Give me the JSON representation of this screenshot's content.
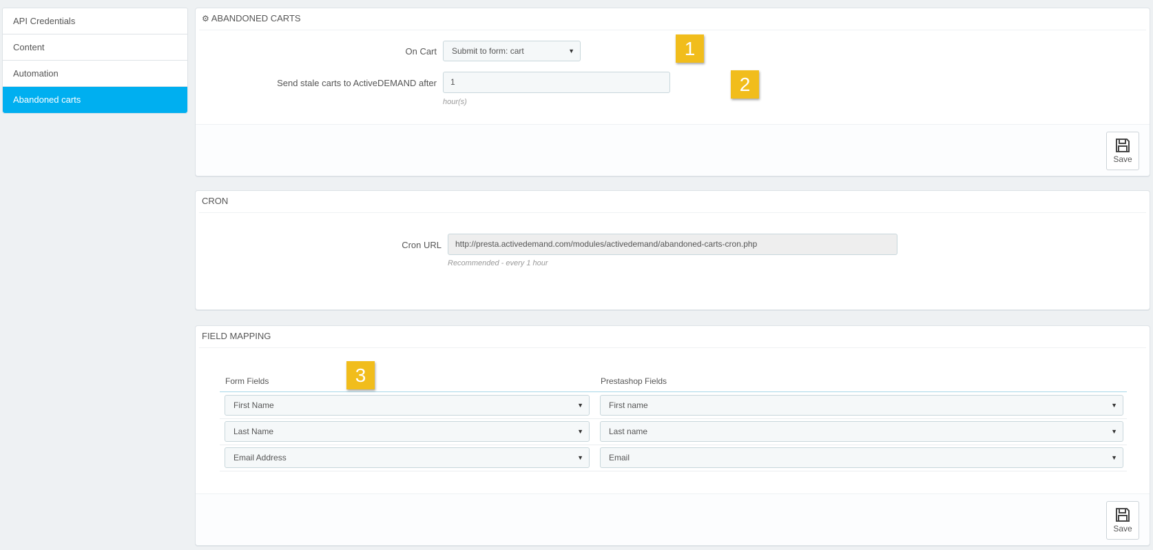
{
  "sidebar": {
    "items": [
      {
        "label": "API Credentials"
      },
      {
        "label": "Content"
      },
      {
        "label": "Automation"
      },
      {
        "label": "Abandoned carts"
      }
    ]
  },
  "abandoned": {
    "title": "ABANDONED CARTS",
    "on_cart_label": "On Cart",
    "on_cart_value": "Submit to form: cart",
    "stale_label": "Send stale carts to ActiveDEMAND after",
    "stale_value": "1",
    "stale_help": "hour(s)",
    "save_label": "Save"
  },
  "cron": {
    "title": "CRON",
    "url_label": "Cron URL",
    "url_value": "http://presta.activedemand.com/modules/activedemand/abandoned-carts-cron.php",
    "url_help": "Recommended - every 1 hour"
  },
  "mapping": {
    "title": "FIELD MAPPING",
    "col_form": "Form Fields",
    "col_presta": "Prestashop Fields",
    "rows": [
      {
        "form": "First Name",
        "presta": "First name"
      },
      {
        "form": "Last Name",
        "presta": "Last name"
      },
      {
        "form": "Email Address",
        "presta": "Email"
      }
    ],
    "save_label": "Save"
  },
  "badges": [
    "1",
    "2",
    "3"
  ],
  "colors": {
    "accent": "#00aff0",
    "badge": "#f1bd1c",
    "background": "#eef1f3"
  },
  "icons": {
    "cogs": "cogs-icon",
    "save": "floppy-disk-icon",
    "caret": "caret-down-icon"
  }
}
